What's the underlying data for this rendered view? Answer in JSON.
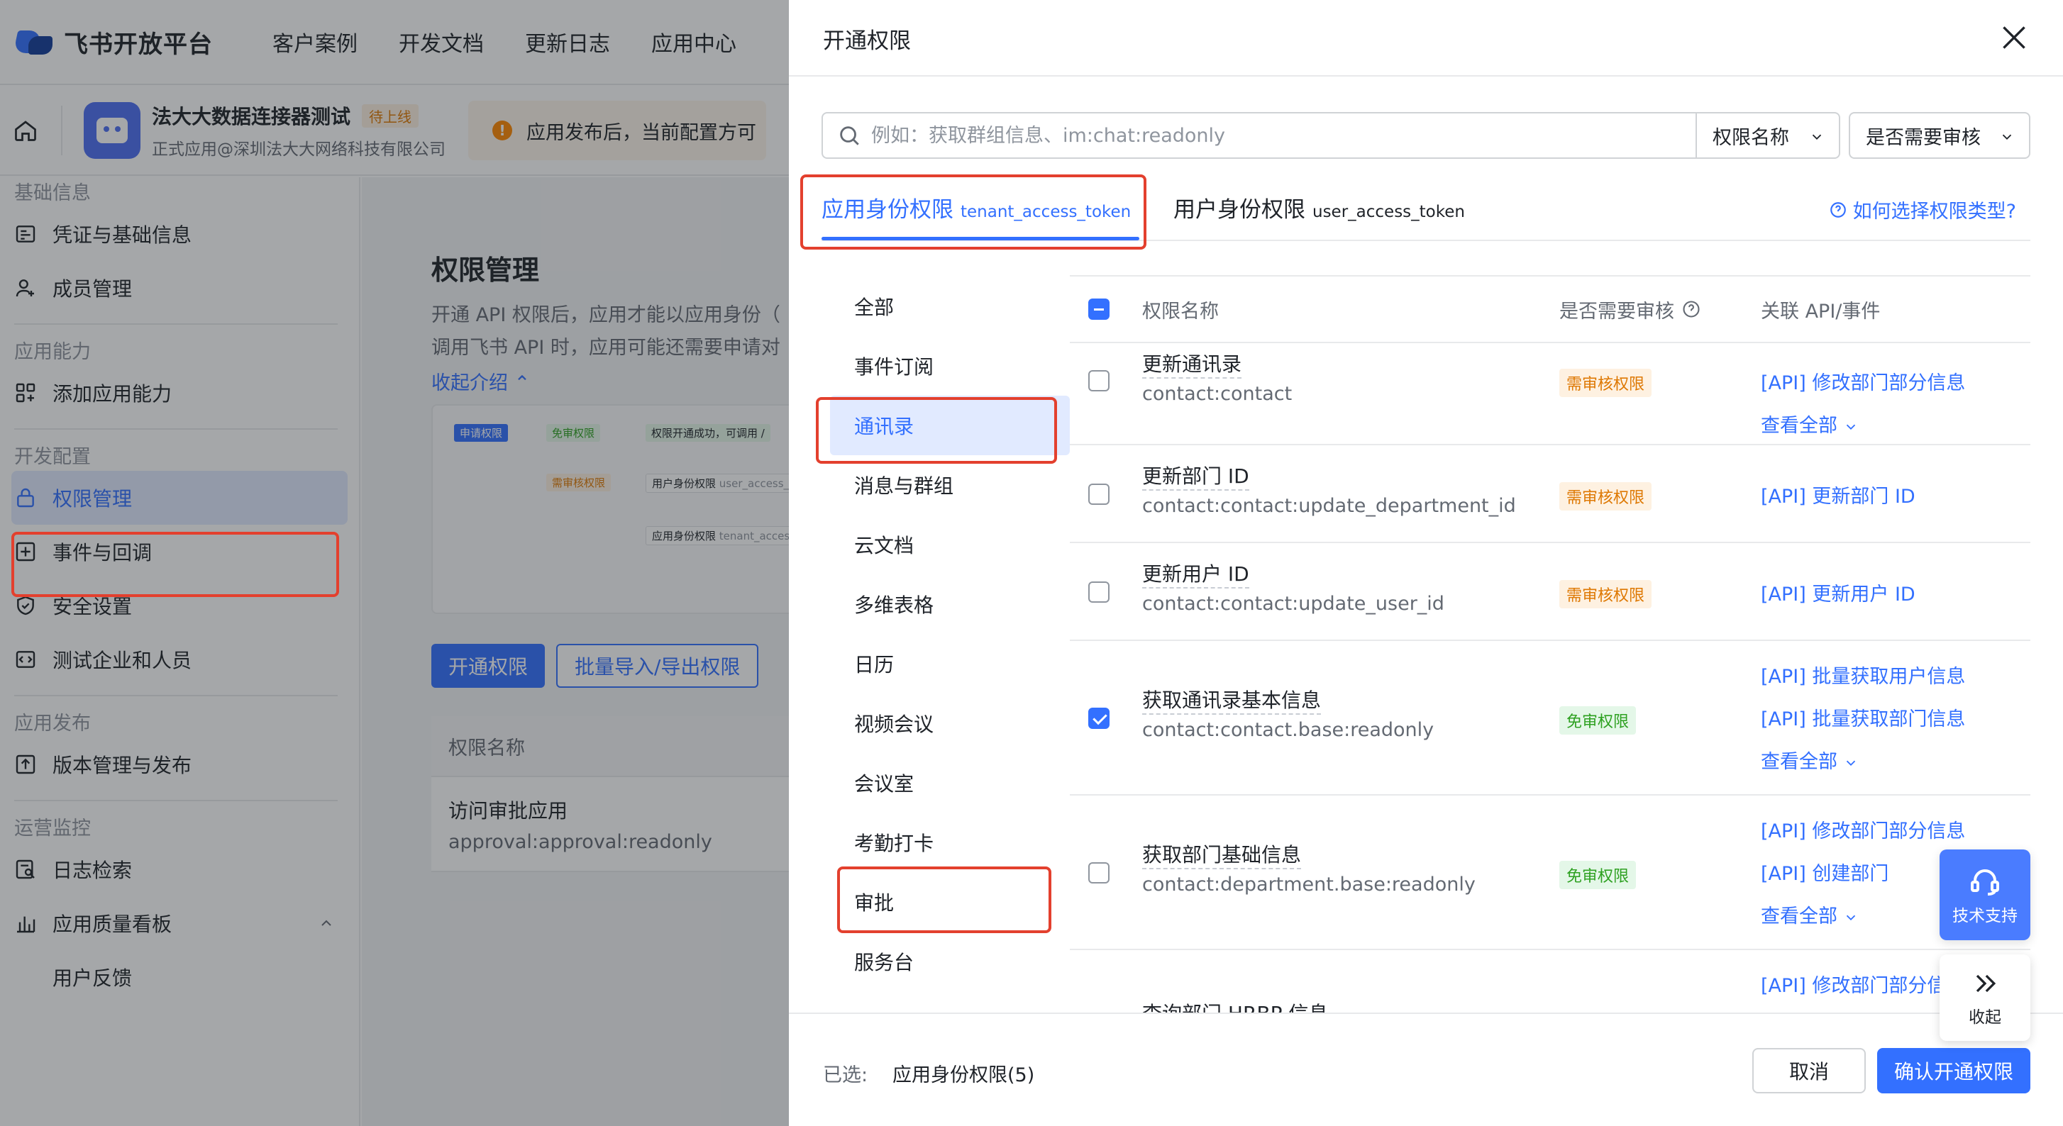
{
  "brand": {
    "name": "飞书开放平台",
    "accent": "#3370ff"
  },
  "topnav": [
    "客户案例",
    "开发文档",
    "更新日志",
    "应用中心"
  ],
  "app": {
    "name": "法大大数据连接器测试",
    "status": "待上线",
    "subtitle": "正式应用@深圳法大大网络科技有限公司",
    "notice": "应用发布后，当前配置方可"
  },
  "sidebar": {
    "groups": [
      {
        "title": "基础信息",
        "items": [
          {
            "label": "凭证与基础信息",
            "icon": "id-card-icon"
          },
          {
            "label": "成员管理",
            "icon": "user-add-icon"
          }
        ]
      },
      {
        "title": "应用能力",
        "items": [
          {
            "label": "添加应用能力",
            "icon": "grid-add-icon"
          }
        ]
      },
      {
        "title": "开发配置",
        "items": [
          {
            "label": "权限管理",
            "icon": "lock-icon",
            "active": true
          },
          {
            "label": "事件与回调",
            "icon": "event-icon"
          },
          {
            "label": "安全设置",
            "icon": "shield-icon"
          },
          {
            "label": "测试企业和人员",
            "icon": "code-icon"
          }
        ]
      },
      {
        "title": "应用发布",
        "items": [
          {
            "label": "版本管理与发布",
            "icon": "upload-icon"
          }
        ]
      },
      {
        "title": "运营监控",
        "items": [
          {
            "label": "日志检索",
            "icon": "log-search-icon"
          },
          {
            "label": "应用质量看板",
            "icon": "bar-chart-icon"
          }
        ]
      }
    ],
    "sub_item": "用户反馈"
  },
  "main": {
    "title": "权限管理",
    "desc_line1": "开通 API 权限后，应用才能以应用身份（",
    "desc_line2": "调用飞书 API 时，应用可能还需要申请对",
    "collapse": "收起介绍",
    "diagram": {
      "apply": "申请权限",
      "free": "免审权限",
      "success": "权限开通成功，可调用 /",
      "need": "需审核权限",
      "user": "用户身份权限",
      "user_token": "user_access_t",
      "app": "应用身份权限",
      "app_token": "tenant_access"
    },
    "btn_open": "开通权限",
    "btn_batch": "批量导入/导出权限",
    "table_head": "权限名称",
    "row_name": "访问审批应用",
    "row_code": "approval:approval:readonly"
  },
  "drawer": {
    "title": "开通权限",
    "search_placeholder": "例如：获取群组信息、im:chat:readonly",
    "filter1": "权限名称",
    "filter2": "是否需要审核",
    "tabs": [
      {
        "label": "应用身份权限",
        "token": "tenant_access_token"
      },
      {
        "label": "用户身份权限",
        "token": "user_access_token"
      }
    ],
    "help": "如何选择权限类型?",
    "categories": [
      "全部",
      "事件订阅",
      "通讯录",
      "消息与群组",
      "云文档",
      "多维表格",
      "日历",
      "视频会议",
      "会议室",
      "考勤打卡",
      "审批",
      "服务台"
    ],
    "active_category": "通讯录",
    "columns": {
      "name": "权限名称",
      "review": "是否需要审核",
      "api": "关联 API/事件"
    },
    "rows": [
      {
        "name": "更新通讯录",
        "code": "contact:contact",
        "badge": "需审核权限",
        "apis": [
          "[API] 修改部门部分信息"
        ],
        "more": "查看全部",
        "checked": false
      },
      {
        "name": "更新部门 ID",
        "code": "contact:contact:update_department_id",
        "badge": "需审核权限",
        "apis": [
          "[API] 更新部门 ID"
        ],
        "checked": false
      },
      {
        "name": "更新用户 ID",
        "code": "contact:contact:update_user_id",
        "badge": "需审核权限",
        "apis": [
          "[API] 更新用户 ID"
        ],
        "checked": false
      },
      {
        "name": "获取通讯录基本信息",
        "code": "contact:contact.base:readonly",
        "badge": "免审权限",
        "apis": [
          "[API] 批量获取用户信息",
          "[API] 批量获取部门信息"
        ],
        "more": "查看全部",
        "checked": true
      },
      {
        "name": "获取部门基础信息",
        "code": "contact:department.base:readonly",
        "badge": "免审权限",
        "apis": [
          "[API] 修改部门部分信息",
          "[API] 创建部门"
        ],
        "more": "查看全部",
        "checked": false
      },
      {
        "name": "查询部门 HRBP 信息",
        "apis": [
          "[API] 修改部门部分信"
        ]
      }
    ],
    "footer": {
      "selected_label": "已选:",
      "selected_value": "应用身份权限(5)",
      "cancel": "取消",
      "confirm": "确认开通权限"
    }
  },
  "floating": {
    "support": "技术支持",
    "collapse": "收起"
  }
}
